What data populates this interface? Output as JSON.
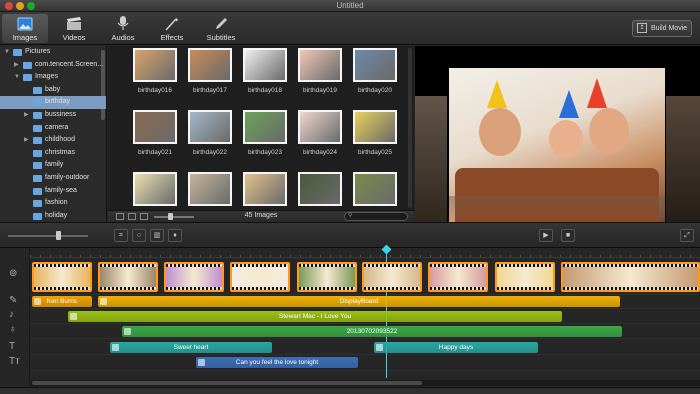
{
  "window": {
    "title": "Untitled"
  },
  "toolbar": {
    "tabs": [
      {
        "label": "Images",
        "icon": "images-icon"
      },
      {
        "label": "Videos",
        "icon": "clapperboard-icon"
      },
      {
        "label": "Audios",
        "icon": "microphone-icon"
      },
      {
        "label": "Effects",
        "icon": "magic-wand-icon"
      },
      {
        "label": "Subtitles",
        "icon": "pencil-icon"
      }
    ],
    "active_tab": "Images",
    "build_label": "Build Movie"
  },
  "sidebar": {
    "items": [
      {
        "label": "Pictures",
        "level": 0,
        "expanded": true
      },
      {
        "label": "com.tencent.Screen...",
        "level": 1,
        "expanded": false
      },
      {
        "label": "Images",
        "level": 1,
        "expanded": true
      },
      {
        "label": "baby",
        "level": 2
      },
      {
        "label": "birthday",
        "level": 2,
        "selected": true
      },
      {
        "label": "bussiness",
        "level": 2,
        "has_children": true
      },
      {
        "label": "camera",
        "level": 2
      },
      {
        "label": "childhood",
        "level": 2,
        "has_children": true
      },
      {
        "label": "christmas",
        "level": 2
      },
      {
        "label": "family",
        "level": 2
      },
      {
        "label": "family-outdoor",
        "level": 2
      },
      {
        "label": "family-sea",
        "level": 2
      },
      {
        "label": "fashion",
        "level": 2
      },
      {
        "label": "holiday",
        "level": 2
      }
    ]
  },
  "media": {
    "thumbnails": [
      {
        "caption": "birthday016",
        "color": "#d9a36a"
      },
      {
        "caption": "birthday017",
        "color": "#c98b58"
      },
      {
        "caption": "birthday018",
        "color": "#f0f0f0"
      },
      {
        "caption": "birthday019",
        "color": "#f2c7b6"
      },
      {
        "caption": "birthday020",
        "color": "#6d8aa8"
      },
      {
        "caption": "birthday021",
        "color": "#8a6a52"
      },
      {
        "caption": "birthday022",
        "color": "#a5b7c7"
      },
      {
        "caption": "birthday023",
        "color": "#6aa35a"
      },
      {
        "caption": "birthday024",
        "color": "#efd7d0"
      },
      {
        "caption": "birthday025",
        "color": "#e8d15a"
      },
      {
        "caption": "",
        "color": "#e8e0b0"
      },
      {
        "caption": "",
        "color": "#c4b59a"
      },
      {
        "caption": "",
        "color": "#e2c28c"
      },
      {
        "caption": "",
        "color": "#4a5a3a"
      },
      {
        "caption": "",
        "color": "#7a8a4a"
      }
    ],
    "count_label": "45 Images",
    "search_placeholder": ""
  },
  "timeline": {
    "video_clips": [
      {
        "color": "#e9b45a"
      },
      {
        "color": "#9b8868"
      },
      {
        "color": "#c08fd0"
      },
      {
        "color": "#f3ece0"
      },
      {
        "color": "#7a9a58"
      },
      {
        "color": "#d6b88a"
      },
      {
        "color": "#d79aa0"
      },
      {
        "color": "#f0d890"
      },
      {
        "color": "#c69a70"
      }
    ],
    "effect_bars": [
      {
        "label": "Ken Burns",
        "color": "#f0a000"
      },
      {
        "label": "DisplayBoard",
        "color": "#f0b000"
      }
    ],
    "audio_bars": [
      {
        "label": "Stewart Mac - I Love You",
        "color": "#9ac010"
      },
      {
        "label": "20130702093522",
        "color": "#3aa844"
      }
    ],
    "text_bars": [
      {
        "label": "Sweet heart",
        "color": "#27a8a0"
      },
      {
        "label": "Happy days",
        "color": "#27a8a0"
      }
    ],
    "subtitle_bars": [
      {
        "label": "Can you feel the love tonight",
        "color": "#3a6fb8"
      }
    ]
  },
  "colors": {
    "accent": "#3fd3e8",
    "clip_border": "#ff9a1a",
    "selection": "#7c9cc4"
  }
}
